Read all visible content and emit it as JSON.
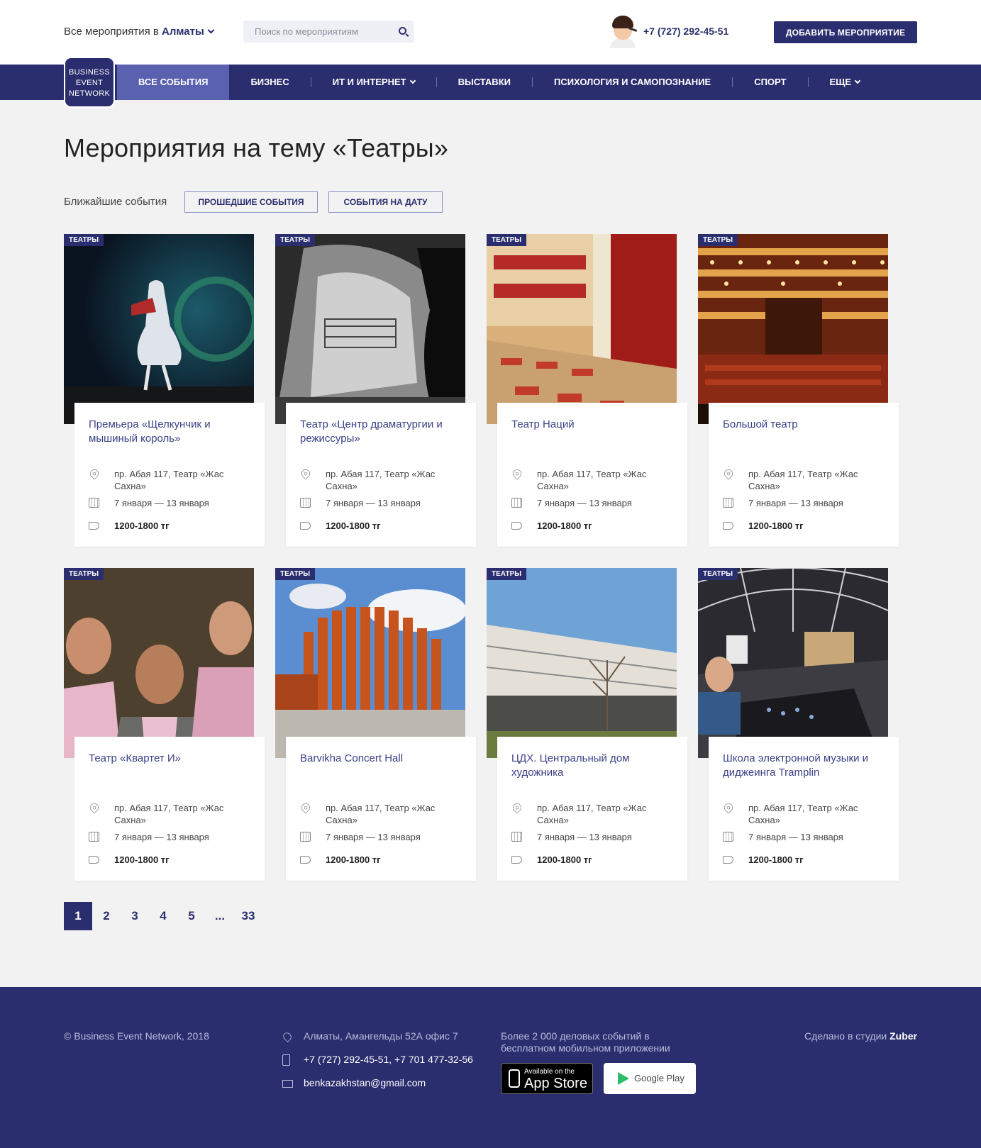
{
  "header": {
    "city_prefix": "Все мероприятия в",
    "city": "Алматы",
    "search_placeholder": "Поиск по мероприятиям",
    "phone": "+7 (727) 292-45-51",
    "add_button": "ДОБАВИТЬ МЕРОПРИЯТИЕ"
  },
  "logo": {
    "line1": "BUSINESS",
    "line2": "EVENT",
    "line3": "NETWORK"
  },
  "nav": {
    "items": [
      {
        "label": "ВСЕ СОБЫТИЯ",
        "active": true
      },
      {
        "label": "БИЗНЕС"
      },
      {
        "label": "ИТ И ИНТЕРНЕТ",
        "dropdown": true
      },
      {
        "label": "ВЫСТАВКИ"
      },
      {
        "label": "ПСИХОЛОГИЯ И САМОПОЗНАНИЕ"
      },
      {
        "label": "СПОРТ"
      },
      {
        "label": "ЕЩЕ",
        "dropdown": true
      }
    ]
  },
  "page": {
    "title": "Мероприятия на тему «Театры»",
    "filter_label": "Ближайшие события",
    "filter_past": "ПРОШЕДШИЕ СОБЫТИЯ",
    "filter_date": "СОБЫТИЯ НА ДАТУ"
  },
  "cards": [
    {
      "badge": "ТЕАТРЫ",
      "title": "Премьера «Щелкунчик и мышиный король»",
      "address": "пр. Абая 117, Театр «Жас Сахна»",
      "dates": "7 января — 13 января",
      "price": "1200-1800 тг"
    },
    {
      "badge": "ТЕАТРЫ",
      "title": "Театр «Центр драматургии и режиссуры»",
      "address": "пр. Абая 117, Театр «Жас Сахна»",
      "dates": "7 января — 13 января",
      "price": "1200-1800 тг"
    },
    {
      "badge": "ТЕАТРЫ",
      "title": "Театр Наций",
      "address": "пр. Абая 117, Театр «Жас Сахна»",
      "dates": "7 января — 13 января",
      "price": "1200-1800 тг"
    },
    {
      "badge": "ТЕАТРЫ",
      "title": "Большой театр",
      "address": "пр. Абая 117, Театр «Жас Сахна»",
      "dates": "7 января — 13 января",
      "price": "1200-1800 тг"
    },
    {
      "badge": "ТЕАТРЫ",
      "title": "Театр «Квартет И»",
      "address": "пр. Абая 117, Театр «Жас Сахна»",
      "dates": "7 января — 13 января",
      "price": "1200-1800 тг"
    },
    {
      "badge": "ТЕАТРЫ",
      "title": "Barvikha Concert Hall",
      "address": "пр. Абая 117, Театр «Жас Сахна»",
      "dates": "7 января — 13 января",
      "price": "1200-1800 тг"
    },
    {
      "badge": "ТЕАТРЫ",
      "title": "ЦДХ. Центральный дом художника",
      "address": "пр. Абая 117, Театр «Жас Сахна»",
      "dates": "7 января — 13 января",
      "price": "1200-1800 тг"
    },
    {
      "badge": "ТЕАТРЫ",
      "title": "Школа электронной музыки и диджеинга Tramplin",
      "address": "пр. Абая 117, Театр «Жас Сахна»",
      "dates": "7 января — 13 января",
      "price": "1200-1800 тг"
    }
  ],
  "pager": [
    "1",
    "2",
    "3",
    "4",
    "5",
    "...",
    "33"
  ],
  "footer": {
    "copyright": "© Business Event Network, 2018",
    "address": "Алматы, Амангельды 52А офис 7",
    "phones": "+7 (727) 292-45-51, +7 701 477-32-56",
    "email": "benkazakhstan@gmail.com",
    "app_text": "Более 2 000 деловых событий в бесплатном мобильном приложении",
    "appstore_small": "Available on the",
    "appstore_big": "App Store",
    "googleplay": "Google Play",
    "made_prefix": "Сделано в студии",
    "made_studio": "Zuber"
  },
  "colors": {
    "brand": "#2b2e6e",
    "nav_active": "#5a62b0",
    "background": "#f2f2f2"
  }
}
